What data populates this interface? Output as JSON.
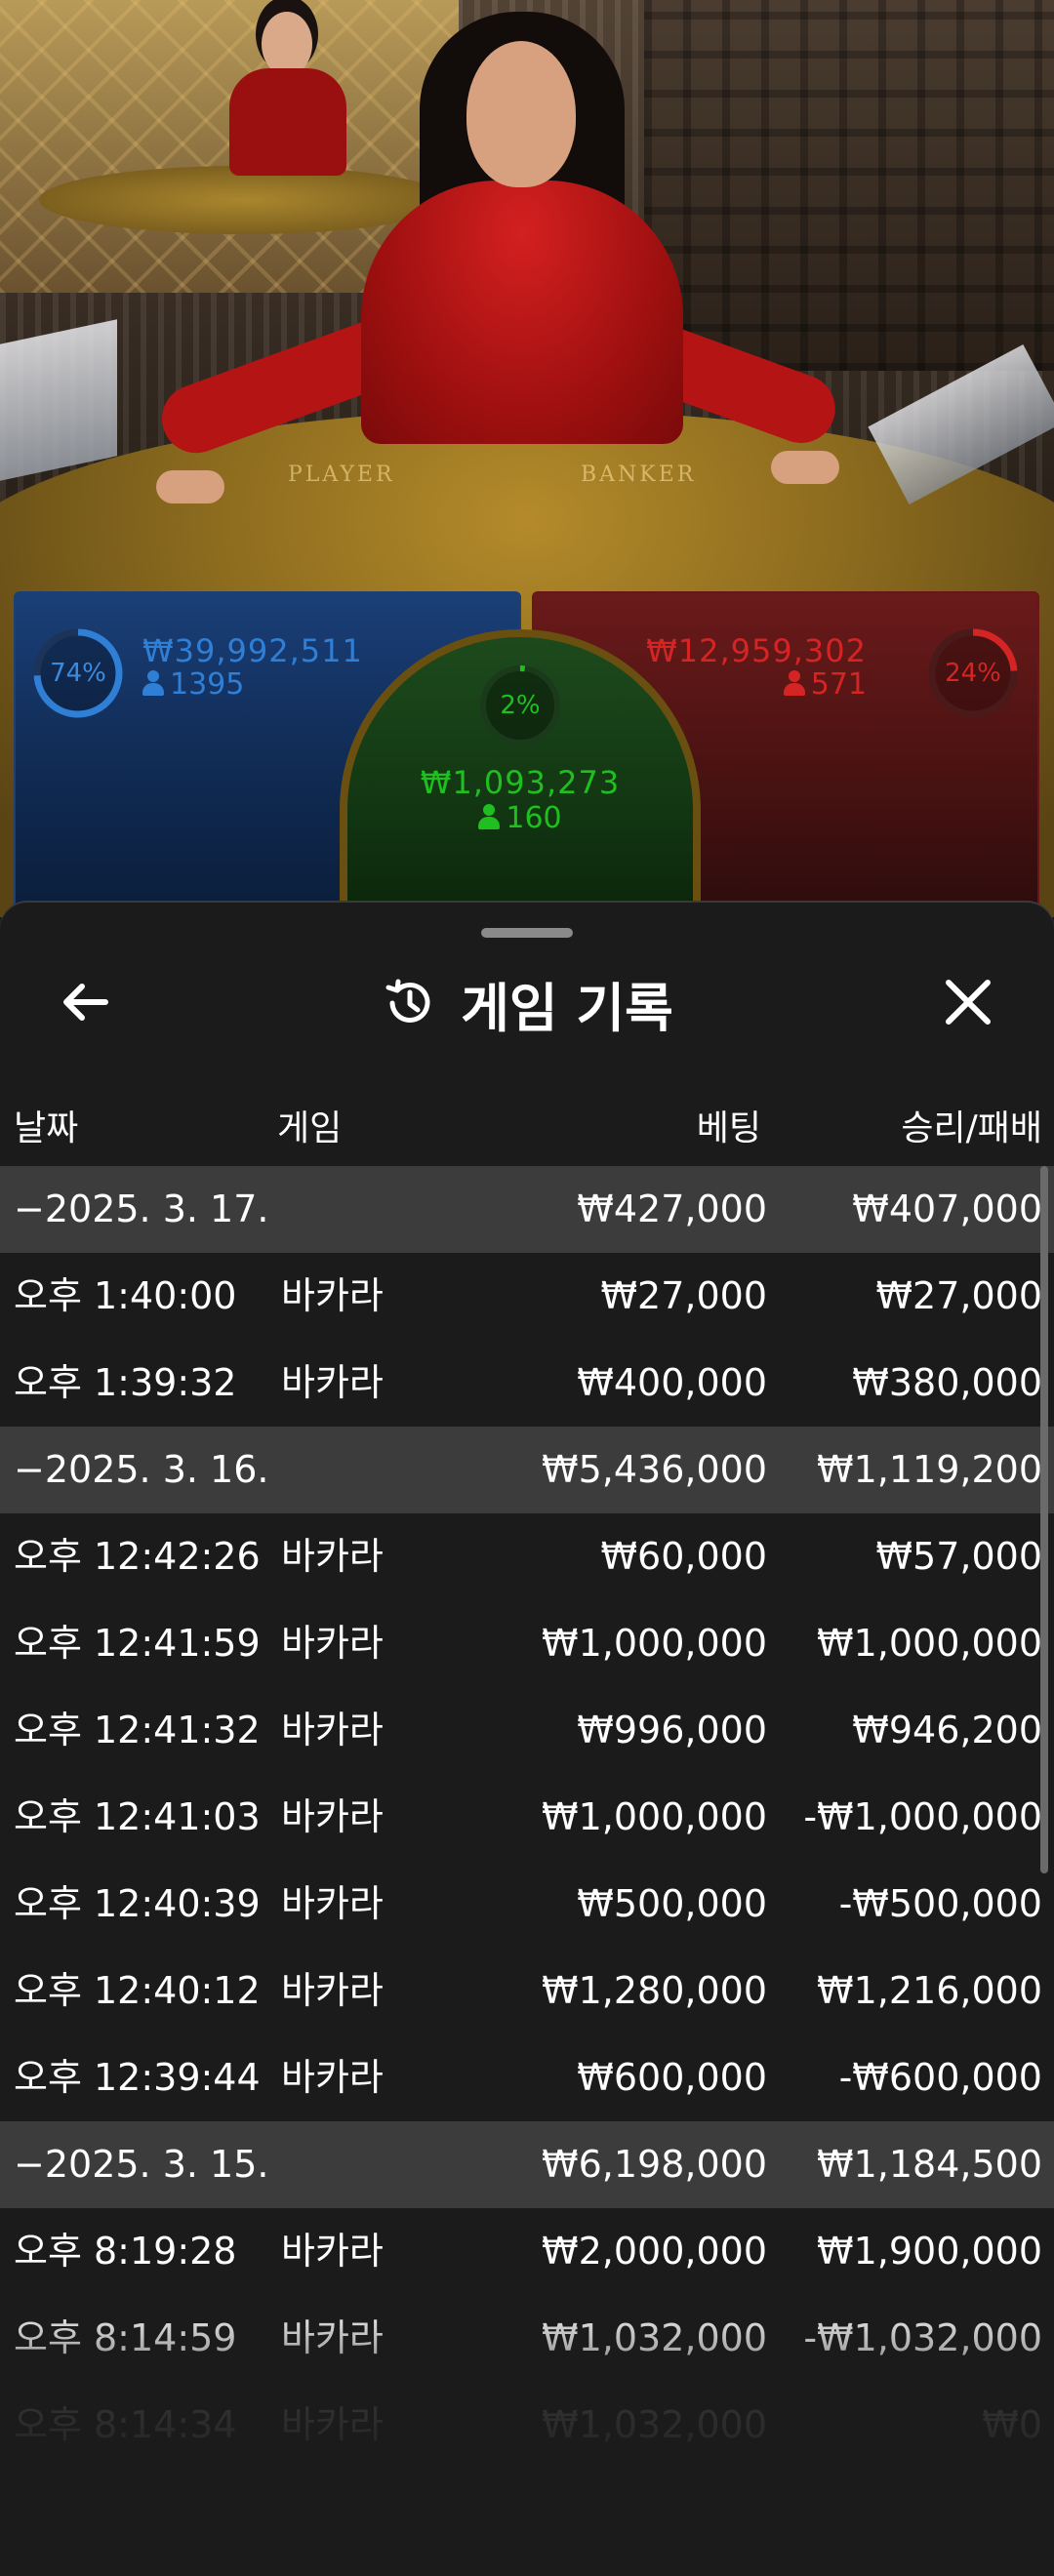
{
  "bet_panels": {
    "player": {
      "percent": "74%",
      "amount": "₩39,992,511",
      "players": "1395",
      "color": "#2f7fd6"
    },
    "tie": {
      "percent": "2%",
      "amount": "₩1,093,273",
      "players": "160",
      "color": "#1fbf1f"
    },
    "banker": {
      "percent": "24%",
      "amount": "₩12,959,302",
      "players": "571",
      "color": "#d42424"
    }
  },
  "table_labels": {
    "player": "PLAYER",
    "banker": "BANKER"
  },
  "sheet": {
    "title": "게임 기록",
    "icons": {
      "back": "arrow-left-icon",
      "history": "history-icon",
      "close": "close-icon"
    },
    "columns": {
      "date": "날짜",
      "game": "게임",
      "bet": "베팅",
      "winloss": "승리/패배"
    },
    "rows": [
      {
        "type": "date",
        "label": "−2025. 3. 17.",
        "bet": "₩427,000",
        "winloss": "₩407,000"
      },
      {
        "type": "entry",
        "time": "오후 1:40:00",
        "game": "바카라",
        "bet": "₩27,000",
        "winloss": "₩27,000"
      },
      {
        "type": "entry",
        "time": "오후 1:39:32",
        "game": "바카라",
        "bet": "₩400,000",
        "winloss": "₩380,000"
      },
      {
        "type": "date",
        "label": "−2025. 3. 16.",
        "bet": "₩5,436,000",
        "winloss": "₩1,119,200"
      },
      {
        "type": "entry",
        "time": "오후 12:42:26",
        "game": "바카라",
        "bet": "₩60,000",
        "winloss": "₩57,000"
      },
      {
        "type": "entry",
        "time": "오후 12:41:59",
        "game": "바카라",
        "bet": "₩1,000,000",
        "winloss": "₩1,000,000"
      },
      {
        "type": "entry",
        "time": "오후 12:41:32",
        "game": "바카라",
        "bet": "₩996,000",
        "winloss": "₩946,200"
      },
      {
        "type": "entry",
        "time": "오후 12:41:03",
        "game": "바카라",
        "bet": "₩1,000,000",
        "winloss": "-₩1,000,000"
      },
      {
        "type": "entry",
        "time": "오후 12:40:39",
        "game": "바카라",
        "bet": "₩500,000",
        "winloss": "-₩500,000"
      },
      {
        "type": "entry",
        "time": "오후 12:40:12",
        "game": "바카라",
        "bet": "₩1,280,000",
        "winloss": "₩1,216,000"
      },
      {
        "type": "entry",
        "time": "오후 12:39:44",
        "game": "바카라",
        "bet": "₩600,000",
        "winloss": "-₩600,000"
      },
      {
        "type": "date",
        "label": "−2025. 3. 15.",
        "bet": "₩6,198,000",
        "winloss": "₩1,184,500"
      },
      {
        "type": "entry",
        "time": "오후 8:19:28",
        "game": "바카라",
        "bet": "₩2,000,000",
        "winloss": "₩1,900,000"
      },
      {
        "type": "entry",
        "time": "오후 8:14:59",
        "game": "바카라",
        "bet": "₩1,032,000",
        "winloss": "-₩1,032,000"
      },
      {
        "type": "entry",
        "time": "오후 8:14:34",
        "game": "바카라",
        "bet": "₩1,032,000",
        "winloss": "₩0"
      }
    ]
  }
}
